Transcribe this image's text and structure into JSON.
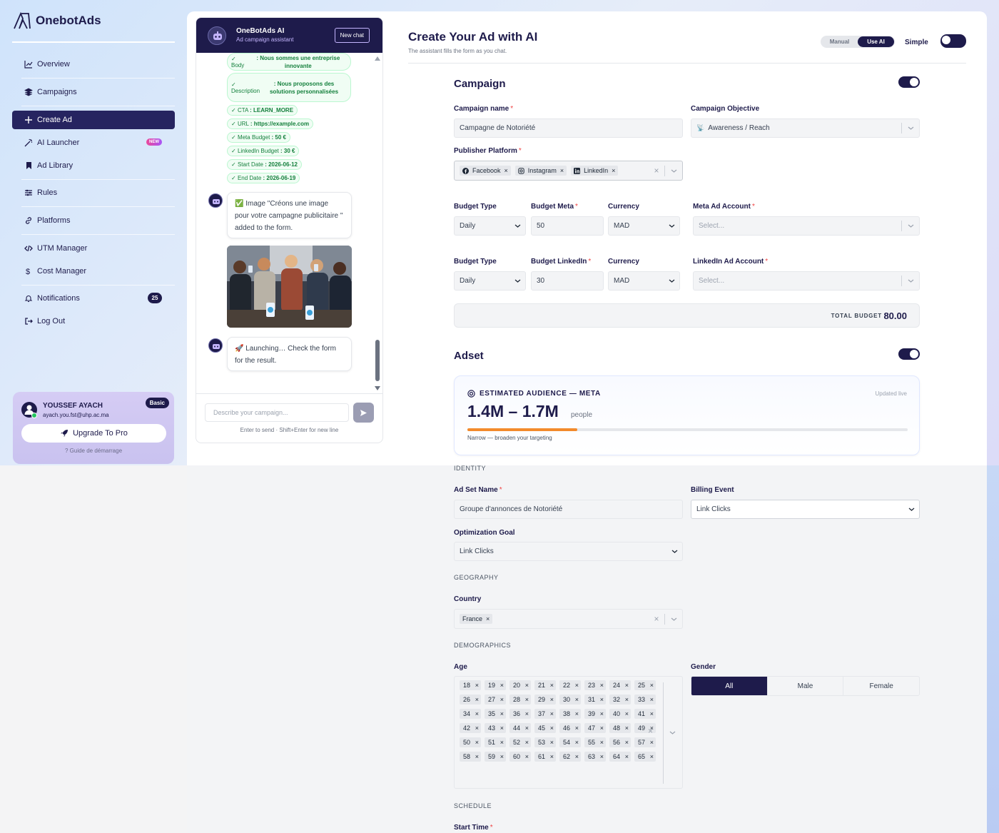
{
  "app": {
    "logo_text": "OnebotAds"
  },
  "sidebar": {
    "items": [
      {
        "label": "Overview",
        "icon": "chart-line-icon"
      },
      {
        "label": "Campaigns",
        "icon": "layers-icon"
      },
      {
        "label": "Create Ad",
        "icon": "plus-icon"
      },
      {
        "label": "AI Launcher",
        "icon": "magic-wand-icon",
        "badge": "NEW"
      },
      {
        "label": "Ad Library",
        "icon": "bookmark-icon"
      },
      {
        "label": "Rules",
        "icon": "sliders-icon"
      },
      {
        "label": "Platforms",
        "icon": "link-icon"
      },
      {
        "label": "UTM Manager",
        "icon": "code-icon"
      },
      {
        "label": "Cost Manager",
        "icon": "dollar-icon"
      },
      {
        "label": "Notifications",
        "icon": "bell-icon",
        "count": "25"
      },
      {
        "label": "Log Out",
        "icon": "logout-icon"
      }
    ],
    "user": {
      "name": "YOUSSEF AYACH",
      "email": "ayach.you.fst@uhp.ac.ma",
      "plan": "Basic",
      "upgrade_label": "Upgrade To Pro",
      "guide_label": "? Guide de démarrage"
    }
  },
  "chat": {
    "title": "OneBotAds AI",
    "subtitle": "Ad campaign assistant",
    "new_chat_label": "New chat",
    "chips": [
      {
        "key": "Body",
        "value": ": Nous sommes une entreprise innovante"
      },
      {
        "key": "Description",
        "value": ": Nous proposons des solutions personnalisées"
      },
      {
        "key": "CTA",
        "value": ": LEARN_MORE"
      },
      {
        "key": "URL",
        "value": ": https://example.com"
      },
      {
        "key": "Meta Budget",
        "value": ": 50 €"
      },
      {
        "key": "LinkedIn Budget",
        "value": ": 30 €"
      },
      {
        "key": "Start Date",
        "value": ": 2026-06-12"
      },
      {
        "key": "End Date",
        "value": ": 2026-06-19"
      }
    ],
    "message_image": "✅ Image \"Créons une image pour votre campagne publicitaire \" added to the form.",
    "message_launch": "🚀 Launching… Check the form for the result.",
    "input_placeholder": "Describe your campaign...",
    "hint": "Enter to send · Shift+Enter for new line"
  },
  "form": {
    "title": "Create Your Ad with AI",
    "subtitle": "The assistant fills the form as you chat.",
    "mode_manual": "Manual",
    "mode_ai": "Use AI",
    "simple_label": "Simple",
    "campaign": {
      "section_title": "Campaign",
      "name_label": "Campaign name",
      "name_value": "Campagne de Notoriété",
      "objective_label": "Campaign Objective",
      "objective_value": "Awareness / Reach",
      "platform_label": "Publisher Platform",
      "platforms": [
        "Facebook",
        "Instagram",
        "LinkedIn"
      ],
      "meta_row": {
        "budget_type_label": "Budget Type",
        "budget_type": "Daily",
        "budget_label": "Budget Meta",
        "budget": "50",
        "currency_label": "Currency",
        "currency": "MAD",
        "account_label": "Meta Ad Account",
        "account_placeholder": "Select..."
      },
      "linkedin_row": {
        "budget_type_label": "Budget Type",
        "budget_type": "Daily",
        "budget_label": "Budget LinkedIn",
        "budget": "30",
        "currency_label": "Currency",
        "currency": "MAD",
        "account_label": "LinkedIn Ad Account",
        "account_placeholder": "Select..."
      },
      "total_label": "TOTAL BUDGET",
      "total_value": "80.00"
    },
    "adset": {
      "section_title": "Adset",
      "audience_title": "ESTIMATED AUDIENCE — META",
      "audience_updated": "Updated live",
      "audience_range": "1.4M – 1.7M",
      "audience_unit": "people",
      "audience_fill": 0.25,
      "audience_note": "Narrow — broaden your targeting",
      "identity_head": "IDENTITY",
      "adset_name_label": "Ad Set Name",
      "adset_name_value": "Groupe d'annonces de Notoriété",
      "billing_label": "Billing Event",
      "billing_value": "Link Clicks",
      "opt_label": "Optimization Goal",
      "opt_value": "Link Clicks",
      "geo_head": "GEOGRAPHY",
      "country_label": "Country",
      "country_value": "France",
      "demo_head": "DEMOGRAPHICS",
      "age_label": "Age",
      "ages": [
        "18",
        "19",
        "20",
        "21",
        "22",
        "23",
        "24",
        "25",
        "26",
        "27",
        "28",
        "29",
        "30",
        "31",
        "32",
        "33",
        "34",
        "35",
        "36",
        "37",
        "38",
        "39",
        "40",
        "41",
        "42",
        "43",
        "44",
        "45",
        "46",
        "47",
        "48",
        "49",
        "50",
        "51",
        "52",
        "53",
        "54",
        "55",
        "56",
        "57",
        "58",
        "59",
        "60",
        "61",
        "62",
        "63",
        "64",
        "65"
      ],
      "gender_label": "Gender",
      "genders": [
        "All",
        "Male",
        "Female"
      ],
      "schedule_head": "SCHEDULE",
      "start_label": "Start Time"
    }
  }
}
